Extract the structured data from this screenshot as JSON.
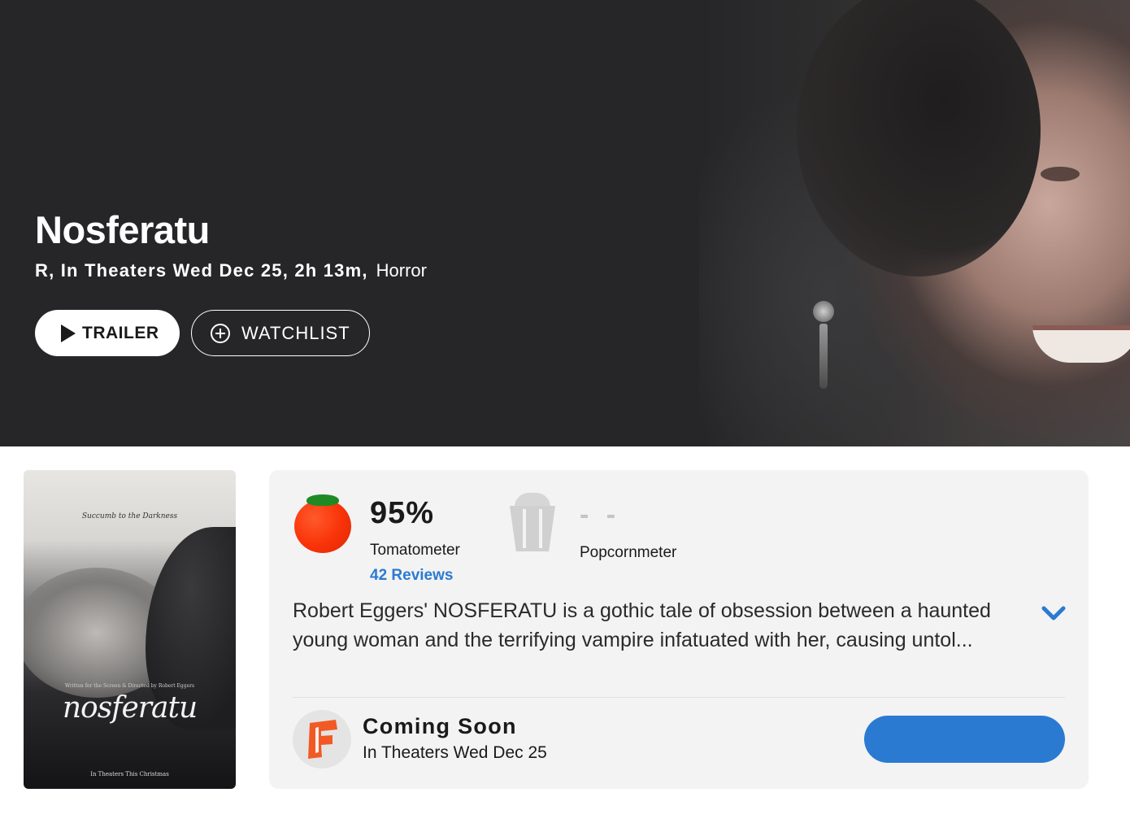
{
  "hero": {
    "title": "Nosferatu",
    "meta_main": "R, In Theaters Wed Dec 25, 2h 13m,",
    "meta_genre": "Horror",
    "trailer_label": "TRAILER",
    "watchlist_label": "WATCHLIST"
  },
  "poster": {
    "tagline": "Succumb to the Darkness",
    "credits": "Written for the Screen & Directed by Robert Eggers",
    "logo": "nosferatu",
    "release": "In Theaters This Christmas"
  },
  "scores": {
    "tomatometer_value": "95%",
    "tomatometer_label": "Tomatometer",
    "reviews_link": "42 Reviews",
    "popcornmeter_value": "- -",
    "popcornmeter_label": "Popcornmeter"
  },
  "synopsis": "Robert Eggers' NOSFERATU is a gothic tale of obsession between a haunted young woman and the terrifying vampire infatuated with her, causing untol...",
  "showtimes": {
    "status": "Coming Soon",
    "date_text": "In Theaters Wed Dec 25"
  },
  "colors": {
    "hero_background": "#262628",
    "accent_blue": "#2a7ad2",
    "tomato_red": "#f93208",
    "card_background": "#f3f3f3",
    "fandango_orange": "#f15a24"
  },
  "icons": [
    "play-icon",
    "plus-circle-icon",
    "tomato-icon",
    "popcorn-icon",
    "chevron-down-icon",
    "fandango-icon"
  ]
}
